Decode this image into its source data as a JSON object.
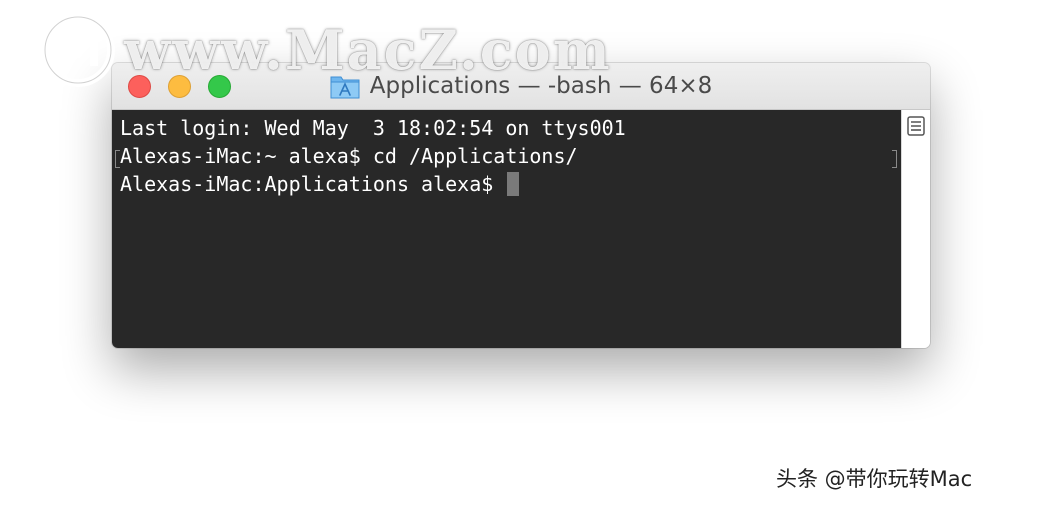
{
  "watermark": {
    "logo_icon": "macz-logo-icon",
    "text": "www.MacZ.com"
  },
  "window": {
    "title": "Applications — -bash — 64×8",
    "title_icon": "applications-folder-icon",
    "traffic_lights": {
      "close": "#fc605c",
      "minimize": "#fdbc40",
      "zoom": "#34c84a"
    }
  },
  "terminal": {
    "background": "#282828",
    "foreground": "#ffffff",
    "lines": [
      "Last login: Wed May  3 18:02:54 on ttys001",
      "Alexas-iMac:~ alexa$ cd /Applications/",
      "Alexas-iMac:Applications alexa$ "
    ]
  },
  "scrollbar": {
    "icon": "marks-list-icon"
  },
  "caption": "头条 @带你玩转Mac"
}
